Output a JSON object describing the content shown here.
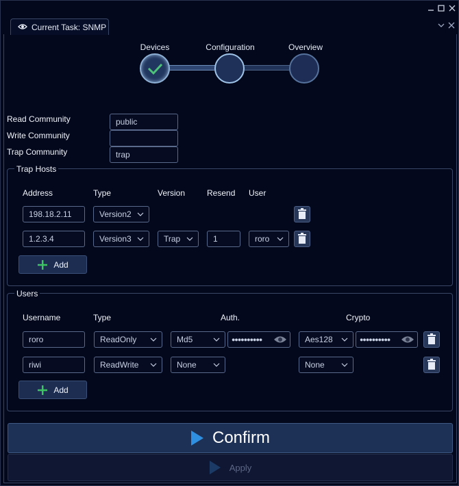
{
  "tab": {
    "title": "Current Task: SNMP"
  },
  "stepper": {
    "steps": [
      {
        "label": "Devices"
      },
      {
        "label": "Configuration"
      },
      {
        "label": "Overview"
      }
    ]
  },
  "communities": {
    "read_label": "Read Community",
    "read_value": "public",
    "write_label": "Write Community",
    "write_value": "",
    "trap_label": "Trap Community",
    "trap_value": "trap"
  },
  "trap_hosts": {
    "title": "Trap Hosts",
    "columns": {
      "address": "Address",
      "type": "Type",
      "version": "Version",
      "resend": "Resend",
      "user": "User"
    },
    "rows": [
      {
        "address": "198.18.2.11",
        "type": "Version2"
      },
      {
        "address": "1.2.3.4",
        "type": "Version3",
        "version": "Trap",
        "resend": "1",
        "user": "roro"
      }
    ],
    "add_label": "Add"
  },
  "users": {
    "title": "Users",
    "columns": {
      "username": "Username",
      "type": "Type",
      "auth": "Auth.",
      "crypto": "Crypto"
    },
    "rows": [
      {
        "username": "roro",
        "type": "ReadOnly",
        "auth": "Md5",
        "crypto": "Aes128"
      },
      {
        "username": "riwi",
        "type": "ReadWrite",
        "auth": "None",
        "crypto": "None"
      }
    ],
    "add_label": "Add"
  },
  "actions": {
    "confirm_label": "Confirm",
    "apply_label": "Apply"
  },
  "colors": {
    "background": "#03081c",
    "accent": "#2f8fe0",
    "add_plus": "#3cc463",
    "check": "#4ec27a"
  }
}
